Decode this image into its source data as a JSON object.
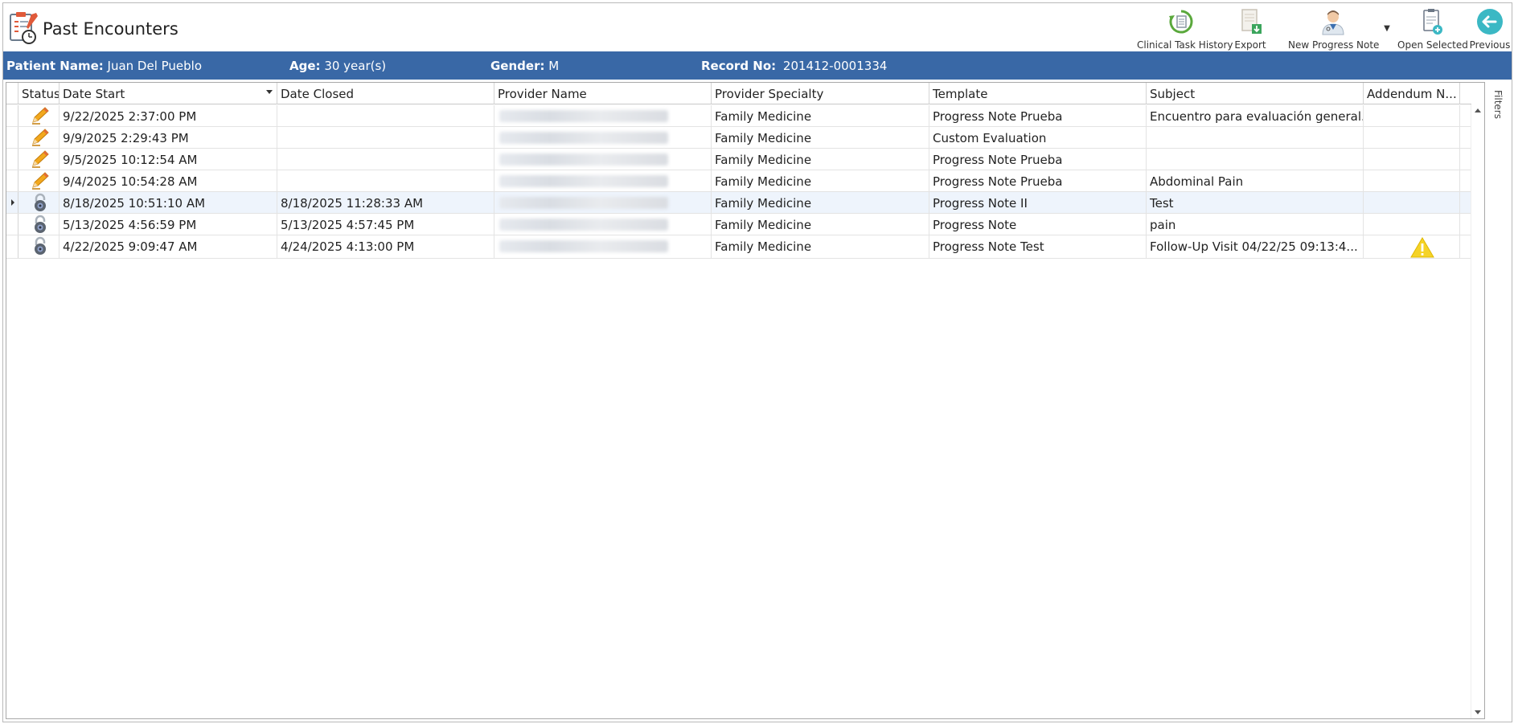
{
  "header": {
    "title": "Past Encounters"
  },
  "toolbar": {
    "clinical_task_history": "Clinical Task History",
    "export": "Export",
    "new_progress_note": "New Progress Note",
    "open_selected": "Open Selected",
    "previous": "Previous"
  },
  "patient": {
    "name_label": "Patient Name:",
    "name": "Juan Del Pueblo",
    "age_label": "Age:",
    "age": "30 year(s)",
    "gender_label": "Gender:",
    "gender": "M",
    "record_label": "Record No:",
    "record": "201412-0001334"
  },
  "grid": {
    "columns": [
      "Status",
      "Date Start",
      "Date Closed",
      "Provider Name",
      "Provider Specialty",
      "Template",
      "Subject",
      "Addendum N..."
    ],
    "rows": [
      {
        "status": "edit",
        "date_start": "9/22/2025 2:37:00 PM",
        "date_closed": "",
        "specialty": "Family Medicine",
        "template": "Progress Note Prueba",
        "subject": "Encuentro para evaluación general.",
        "addendum": ""
      },
      {
        "status": "edit",
        "date_start": "9/9/2025 2:29:43 PM",
        "date_closed": "",
        "specialty": "Family Medicine",
        "template": "Custom Evaluation",
        "subject": "",
        "addendum": ""
      },
      {
        "status": "edit",
        "date_start": "9/5/2025 10:12:54 AM",
        "date_closed": "",
        "specialty": "Family Medicine",
        "template": "Progress Note Prueba",
        "subject": "",
        "addendum": ""
      },
      {
        "status": "edit",
        "date_start": "9/4/2025 10:54:28 AM",
        "date_closed": "",
        "specialty": "Family Medicine",
        "template": "Progress Note Prueba",
        "subject": "Abdominal Pain",
        "addendum": ""
      },
      {
        "status": "locked",
        "date_start": "8/18/2025 10:51:10 AM",
        "date_closed": "8/18/2025 11:28:33 AM",
        "specialty": "Family Medicine",
        "template": "Progress Note II",
        "subject": "Test",
        "addendum": ""
      },
      {
        "status": "locked",
        "date_start": "5/13/2025 4:56:59 PM",
        "date_closed": "5/13/2025 4:57:45 PM",
        "specialty": "Family Medicine",
        "template": "Progress Note",
        "subject": "pain",
        "addendum": ""
      },
      {
        "status": "locked",
        "date_start": "4/22/2025 9:09:47 AM",
        "date_closed": "4/24/2025 4:13:00 PM",
        "specialty": "Family Medicine",
        "template": "Progress Note Test",
        "subject": "  Follow-Up Visit   04/22/25 09:13:4...",
        "addendum": "warning"
      }
    ]
  },
  "side": {
    "filters": "Filters"
  },
  "colors": {
    "patient_bar": "#3968a6",
    "selected_row": "#eef4fc",
    "accent_teal": "#3bb8c4"
  }
}
